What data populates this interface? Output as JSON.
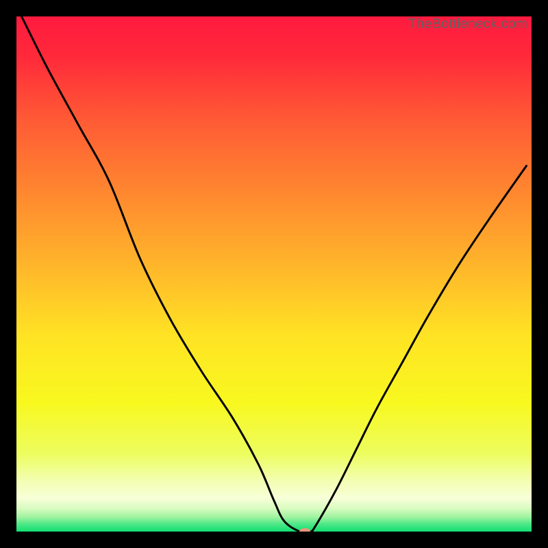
{
  "watermark": "TheBottleneck.com",
  "chart_data": {
    "type": "line",
    "title": "",
    "xlabel": "",
    "ylabel": "",
    "xlim": [
      0,
      100
    ],
    "ylim": [
      0,
      100
    ],
    "grid": false,
    "legend": false,
    "gradient_stops": [
      {
        "offset": 0.0,
        "color": "#ff1a3f"
      },
      {
        "offset": 0.08,
        "color": "#ff2a3a"
      },
      {
        "offset": 0.2,
        "color": "#ff5a35"
      },
      {
        "offset": 0.35,
        "color": "#ff8a2f"
      },
      {
        "offset": 0.5,
        "color": "#ffbb2a"
      },
      {
        "offset": 0.62,
        "color": "#ffe324"
      },
      {
        "offset": 0.75,
        "color": "#f8f81f"
      },
      {
        "offset": 0.85,
        "color": "#edfd60"
      },
      {
        "offset": 0.9,
        "color": "#f3feb0"
      },
      {
        "offset": 0.935,
        "color": "#f7ffd8"
      },
      {
        "offset": 0.955,
        "color": "#d9fbc0"
      },
      {
        "offset": 0.972,
        "color": "#9ff3a0"
      },
      {
        "offset": 0.985,
        "color": "#4fe887"
      },
      {
        "offset": 1.0,
        "color": "#12df72"
      }
    ],
    "series": [
      {
        "name": "bottleneck-curve",
        "color": "#000000",
        "x": [
          1,
          6,
          12,
          18,
          24,
          30,
          36,
          42,
          47,
          50,
          52,
          55,
          57,
          58,
          62,
          66,
          70,
          75,
          80,
          86,
          92,
          99
        ],
        "y": [
          100,
          90,
          79,
          68,
          53,
          41,
          31,
          22,
          13,
          6,
          2,
          0,
          0,
          1,
          8,
          16,
          24,
          33,
          42,
          52,
          61,
          71
        ]
      }
    ],
    "marker": {
      "x": 56,
      "y": 0,
      "color": "#e9967a",
      "rx": 8,
      "ry": 5
    }
  }
}
